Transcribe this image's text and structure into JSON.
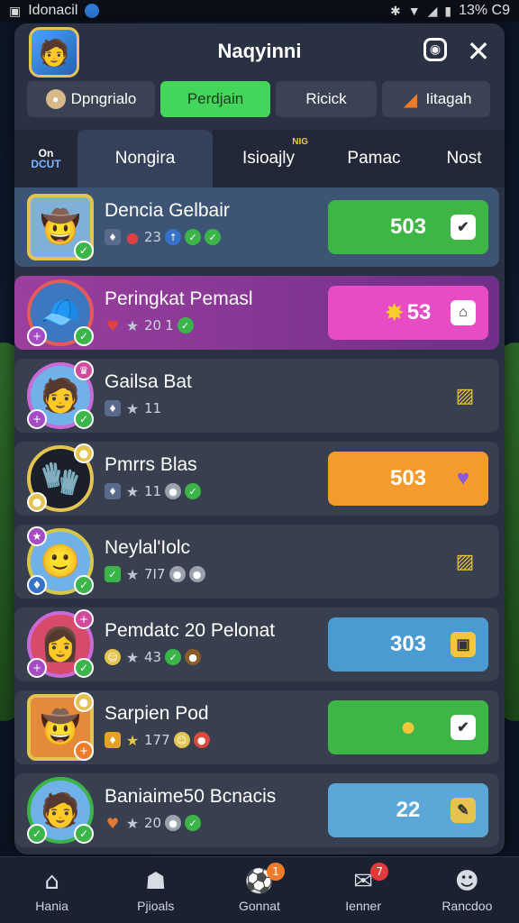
{
  "status_bar": {
    "carrier": "Idonacil",
    "battery_text": "13% C9"
  },
  "header": {
    "title": "Naqyinni"
  },
  "filters": [
    {
      "label": "Dpngrialo",
      "icon": "avatar-icon",
      "active": false
    },
    {
      "label": "Perdjain",
      "active": true
    },
    {
      "label": "Ricick",
      "active": false
    },
    {
      "label": "Iitagah",
      "icon": "flame-icon",
      "active": false
    }
  ],
  "tabs": {
    "mini_top": "On",
    "mini_bottom": "DCUT",
    "items": [
      {
        "label": "Nongira",
        "active": true
      },
      {
        "label": "Isioajly",
        "tag": "NIG"
      },
      {
        "label": "Pamac"
      },
      {
        "label": "Nost"
      }
    ]
  },
  "rows": [
    {
      "name": "Dencia Gelbair",
      "meta": "23",
      "score": "503",
      "button_color": "#3eb646"
    },
    {
      "name": "Peringkat Pemasl",
      "meta": "20",
      "meta2": "1",
      "score": "53",
      "button_color": "#e84cc4"
    },
    {
      "name": "Gailsa Bat",
      "meta": "11",
      "score": "",
      "button_color": ""
    },
    {
      "name": "Pmrrs Blas",
      "meta": "11",
      "score": "503",
      "button_color": "#f59b2e"
    },
    {
      "name": "Neylal'Iolc",
      "meta": "7I7",
      "score": "",
      "button_color": ""
    },
    {
      "name": "Pemdatc 20 Pelonat",
      "meta": "43",
      "score": "303",
      "button_color": "#4b9ad2"
    },
    {
      "name": "Sarpien Pod",
      "meta": "177",
      "score": "",
      "button_color": "#3eb646"
    },
    {
      "name": "Baniaime50 Bcnacis",
      "meta": "20",
      "score": "22",
      "button_color": "#5ba7d8"
    }
  ],
  "bottom_nav": [
    {
      "label": "Hania",
      "icon": "home-icon"
    },
    {
      "label": "Pjioals",
      "icon": "group-icon"
    },
    {
      "label": "Gonnat",
      "icon": "ball-icon",
      "badge": "1"
    },
    {
      "label": "Ienner",
      "icon": "mail-icon",
      "badge": "7"
    },
    {
      "label": "Rancdoo",
      "icon": "profile-icon"
    }
  ]
}
